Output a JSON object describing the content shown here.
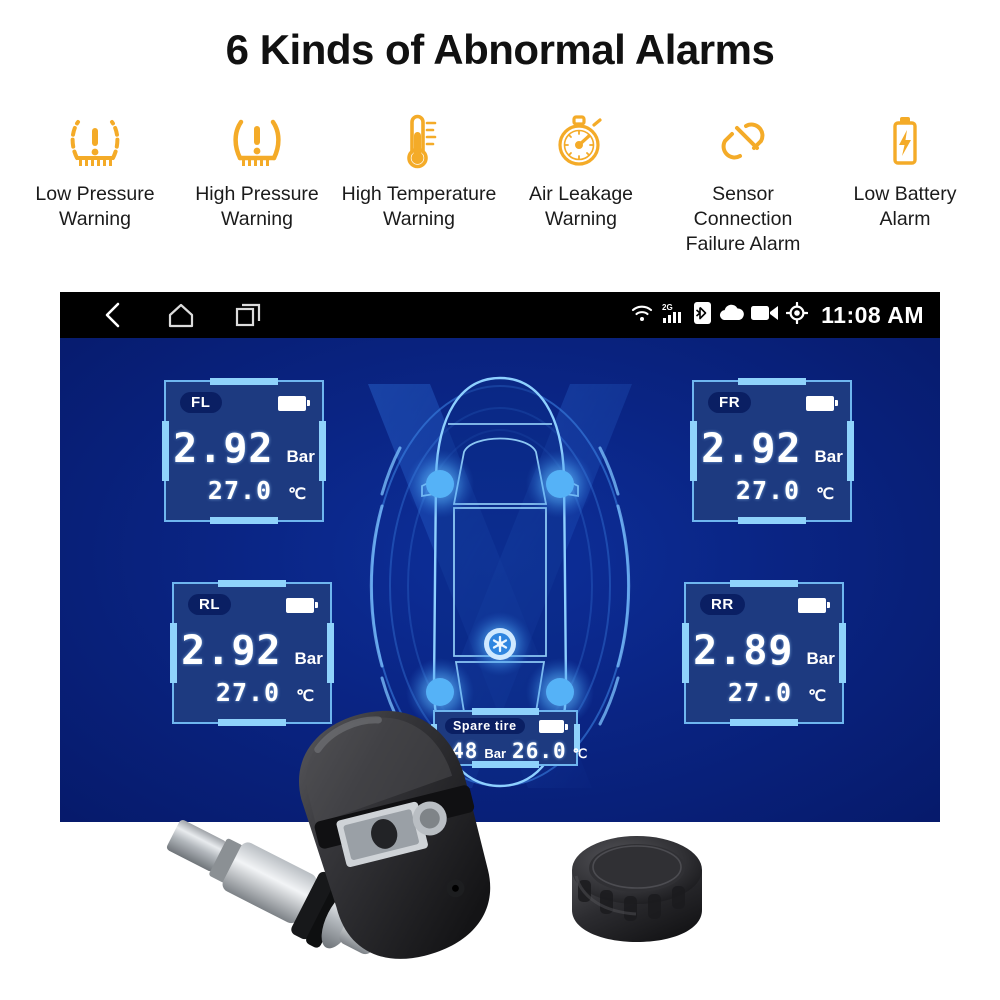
{
  "header": {
    "title": "6 Kinds of Abnormal Alarms"
  },
  "alarms": [
    {
      "icon": "low-tire-pressure-icon",
      "label": "Low Pressure\nWarning"
    },
    {
      "icon": "high-tire-pressure-icon",
      "label": "High Pressure\nWarning"
    },
    {
      "icon": "thermometer-icon",
      "label": "High Temperature\nWarning"
    },
    {
      "icon": "stopwatch-icon",
      "label": "Air Leakage\nWarning"
    },
    {
      "icon": "broken-link-icon",
      "label": "Sensor Connection\nFailure Alarm"
    },
    {
      "icon": "battery-bolt-icon",
      "label": "Low Battery\nAlarm"
    }
  ],
  "device": {
    "statusbar": {
      "nav": [
        {
          "icon": "back-icon"
        },
        {
          "icon": "home-icon"
        },
        {
          "icon": "recents-icon"
        }
      ],
      "indicators": [
        {
          "icon": "wifi-icon"
        },
        {
          "icon": "signal-2g-icon",
          "label": "2G"
        },
        {
          "icon": "bluetooth-icon"
        },
        {
          "icon": "cloud-icon"
        },
        {
          "icon": "video-camera-icon"
        },
        {
          "icon": "gps-target-icon"
        }
      ],
      "clock": "11:08 AM"
    },
    "tires": [
      {
        "position": "FL",
        "pressure": "2.92",
        "pressure_unit": "Bar",
        "temperature": "27.0",
        "temperature_unit": "℃",
        "battery": "full"
      },
      {
        "position": "FR",
        "pressure": "2.92",
        "pressure_unit": "Bar",
        "temperature": "27.0",
        "temperature_unit": "℃",
        "battery": "full"
      },
      {
        "position": "RL",
        "pressure": "2.92",
        "pressure_unit": "Bar",
        "temperature": "27.0",
        "temperature_unit": "℃",
        "battery": "full"
      },
      {
        "position": "RR",
        "pressure": "2.89",
        "pressure_unit": "Bar",
        "temperature": "27.0",
        "temperature_unit": "℃",
        "battery": "full"
      }
    ],
    "spare": {
      "label": "Spare tire",
      "pressure": "2.48",
      "pressure_unit": "Bar",
      "temperature": "26.0",
      "temperature_unit": "℃",
      "battery": "full"
    },
    "car_graphic": {
      "icon": "car-top-view-icon",
      "center_icon": "wheel-hub-icon",
      "wheel_dots": 4
    }
  },
  "products": [
    {
      "name": "internal-tpms-sensor"
    },
    {
      "name": "external-tpms-sensor-cap"
    }
  ],
  "colors": {
    "accent_amber": "#f4ab28",
    "screen_navy": "#061a6b",
    "panel_blue": "#1d3a80",
    "panel_border": "#6fb6ef",
    "panel_edge": "#8fd2fb",
    "title_black": "#111111",
    "statusbar_black": "#000000",
    "lcd_white": "#ffffff"
  }
}
